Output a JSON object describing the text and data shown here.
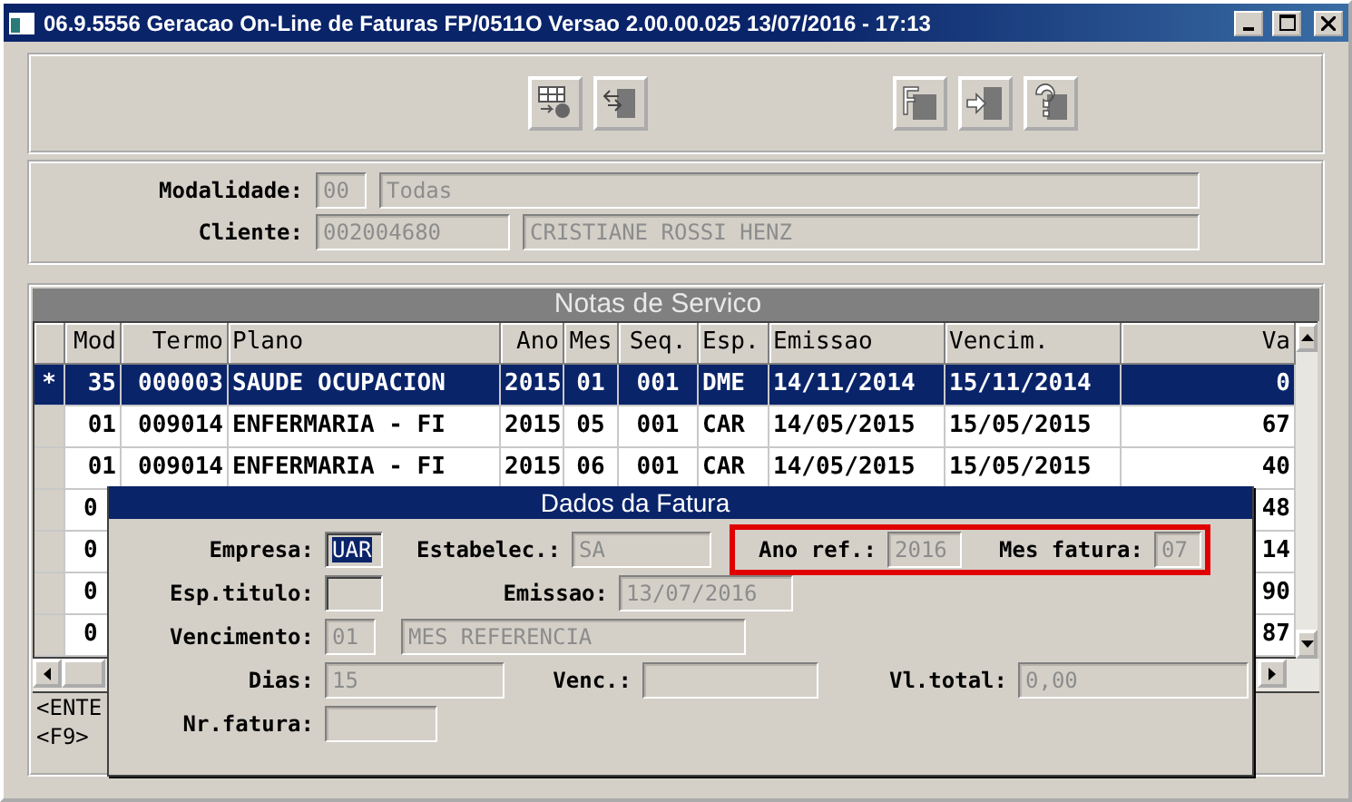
{
  "window": {
    "title": "06.9.5556 Geracao On-Line de Faturas FP/0511O Versao 2.00.00.025 13/07/2016 - 17:13"
  },
  "toolbar": [
    {
      "kind": "process"
    },
    {
      "kind": "back"
    },
    {
      "kind": "gap"
    },
    {
      "kind": "form"
    },
    {
      "kind": "exit"
    },
    {
      "kind": "help"
    }
  ],
  "filters": [
    {
      "label": "Modalidade:",
      "fields": [
        {
          "value": "00",
          "disabled": true
        },
        {
          "value": "Todas",
          "disabled": true
        }
      ]
    },
    {
      "label": "Cliente:",
      "fields": [
        {
          "value": "002004680",
          "disabled": true
        },
        {
          "value": "CRISTIANE ROSSI HENZ",
          "disabled": true
        }
      ]
    }
  ],
  "table": {
    "title": "Notas de Servico",
    "columns": [
      "Mod",
      "Termo",
      "Plano",
      "Ano",
      "Mes",
      "Seq.",
      "Esp.",
      "Emissao",
      "Vencim.",
      "Va"
    ],
    "rows": [
      {
        "marker": "*",
        "selected": true,
        "cells": [
          "35",
          "000003",
          "SAUDE OCUPACION",
          "2015",
          "01",
          "001",
          "DME",
          "14/11/2014",
          "15/11/2014",
          "0"
        ]
      },
      {
        "selected": false,
        "cells": [
          "01",
          "009014",
          "ENFERMARIA - FI",
          "2015",
          "05",
          "001",
          "CAR",
          "14/05/2015",
          "15/05/2015",
          "67"
        ]
      },
      {
        "selected": false,
        "cells": [
          "01",
          "009014",
          "ENFERMARIA - FI",
          "2015",
          "06",
          "001",
          "CAR",
          "14/05/2015",
          "15/05/2015",
          "40"
        ]
      },
      {
        "selected": false,
        "cells": [
          "0",
          null,
          null,
          null,
          null,
          null,
          null,
          null,
          null,
          "48"
        ]
      },
      {
        "selected": false,
        "cells": [
          "0",
          null,
          null,
          null,
          null,
          null,
          null,
          null,
          null,
          "14"
        ]
      },
      {
        "selected": false,
        "cells": [
          "0",
          null,
          null,
          null,
          null,
          null,
          null,
          null,
          null,
          "90"
        ]
      },
      {
        "selected": false,
        "cells": [
          "0",
          null,
          null,
          null,
          null,
          null,
          null,
          null,
          null,
          "87"
        ]
      }
    ],
    "status_lines": [
      "<ENTE",
      "<F9>"
    ]
  },
  "dialog": {
    "title": "Dados da Fatura",
    "rows": [
      [
        {
          "label": "Empresa:",
          "value": "UAR",
          "disabled": false,
          "selected": true
        },
        {
          "label": "Estabelec.:",
          "value": "SA",
          "disabled": true
        },
        {
          "label": "Ano ref.:",
          "value": "2016",
          "disabled": true,
          "highlighted": true
        },
        {
          "label": "Mes fatura:",
          "value": "07",
          "disabled": true,
          "highlighted": true
        }
      ],
      [
        {
          "label": "Esp.titulo:",
          "disabled": false
        },
        {
          "label": "Emissao:",
          "value": "13/07/2016",
          "disabled": true
        }
      ],
      [
        {
          "label": "Vencimento:",
          "value": "01",
          "disabled": true
        },
        {
          "value": "MES REFERENCIA",
          "disabled": true
        }
      ],
      [
        {
          "label": "Dias:",
          "value": "15",
          "disabled": true
        },
        {
          "label": "Venc.:",
          "disabled": true
        },
        {
          "label": "Vl.total:",
          "value": "0,00",
          "disabled": true
        }
      ],
      [
        {
          "label": "Nr.fatura:",
          "disabled": true
        }
      ]
    ]
  }
}
